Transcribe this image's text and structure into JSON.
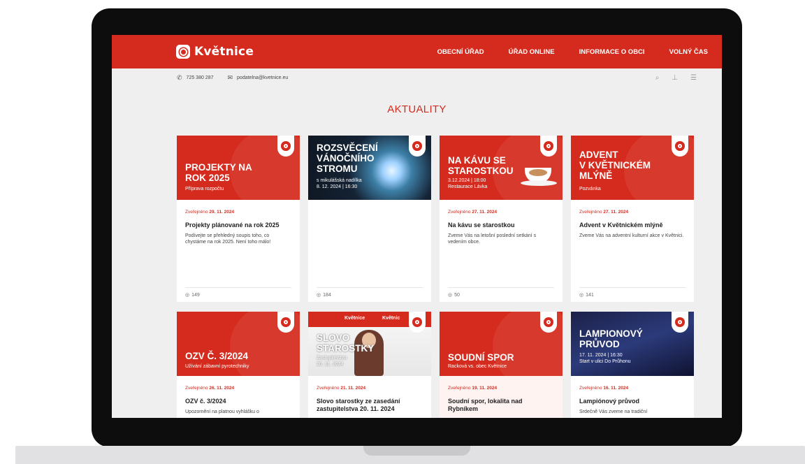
{
  "site": {
    "name": "Květnice"
  },
  "nav": [
    "OBECNÍ ÚŘAD",
    "ÚŘAD ONLINE",
    "INFORMACE O OBCI",
    "VOLNÝ ČAS"
  ],
  "contact": {
    "phone": "725 380 287",
    "email": "podatelna@kvetnice.eu"
  },
  "section": {
    "title": "AKTUALITY"
  },
  "cards": [
    {
      "img_title": "PROJEKTY NA\nROK 2025",
      "img_sub": "Příprava rozpočtu",
      "date_label": "Zveřejněno",
      "date": "29. 11. 2024",
      "title": "Projekty plánované na rok 2025",
      "excerpt": "Podívejte se přehledný soupis toho, co chystáme na rok 2025. Není toho málo!",
      "views": "149"
    },
    {
      "img_title": "ROZSVĚCENÍ\nVÁNOČNÍHO\nSTROMU",
      "img_sub": "s mikulášská nadílka\n8. 12. 2024 | 16:30",
      "date_label": "",
      "date": "",
      "title": "",
      "excerpt": "",
      "views": "184"
    },
    {
      "img_title": "NA KÁVU SE\nSTAROSTKOU",
      "img_sub": "3.12.2024 | 18:00\nRestaurace Lávka",
      "date_label": "Zveřejněno",
      "date": "27. 11. 2024",
      "title": "Na kávu se starostkou",
      "excerpt": "Zveme Vás na letošní poslední setkání s vedením obce.",
      "views": "50"
    },
    {
      "img_title": "ADVENT\nV KVĚTNICKÉM\nMLÝNĚ",
      "img_sub": "Pozvánka",
      "date_label": "Zveřejněno",
      "date": "27. 11. 2024",
      "title": "Advent v Květnickém mlýně",
      "excerpt": "Zveme Vás na adventní kulturní akce v Květnici.",
      "views": "141"
    },
    {
      "img_title": "OZV č. 3/2024",
      "img_sub": "Užívání zábavní pyrotechniky",
      "date_label": "Zveřejněno",
      "date": "26. 11. 2024",
      "title": "OZV č. 3/2024",
      "excerpt": "Upozornění na platnou vyhlášku o",
      "views": ""
    },
    {
      "img_title": "SLOVO\nSTAROSTKY",
      "img_sub": "Zastupitelstvo\n20. 11. 2024",
      "office_labels": [
        "Květnice",
        "Květnic"
      ],
      "date_label": "Zveřejněno",
      "date": "21. 11. 2024",
      "title": "Slovo starostky ze zasedání zastupitelstva 20. 11. 2024",
      "excerpt": "",
      "views": ""
    },
    {
      "img_title": "SOUDNÍ SPOR",
      "img_sub": "Racková vs. obec Květnice",
      "date_label": "Zveřejněno",
      "date": "19. 11. 2024",
      "title": "Soudní spor, lokalita nad Rybníkem",
      "excerpt": "",
      "views": ""
    },
    {
      "img_title": "LAMPIONOVÝ\nPRŮVOD",
      "img_sub": "17. 11. 2024 | 16:30\nStart v ulici Do Průhonu",
      "date_label": "Zveřejněno",
      "date": "16. 11. 2024",
      "title": "Lampiónový průvod",
      "excerpt": "Srdečně Vás zveme na tradiční",
      "views": ""
    }
  ]
}
